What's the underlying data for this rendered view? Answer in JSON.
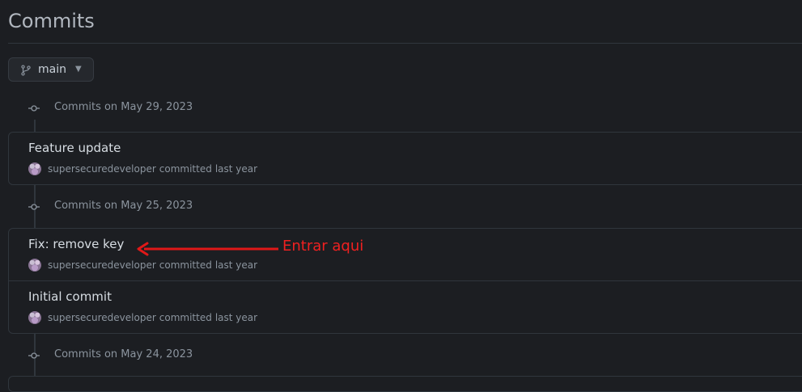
{
  "page": {
    "title": "Commits"
  },
  "branch": {
    "name": "main"
  },
  "groups": [
    {
      "label": "Commits on May 29, 2023",
      "commits": [
        {
          "title": "Feature update",
          "author": "supersecuredeveloper",
          "action": "committed",
          "when": "last year"
        }
      ]
    },
    {
      "label": "Commits on May 25, 2023",
      "commits": [
        {
          "title": "Fix: remove key",
          "author": "supersecuredeveloper",
          "action": "committed",
          "when": "last year"
        },
        {
          "title": "Initial commit",
          "author": "supersecuredeveloper",
          "action": "committed",
          "when": "last year"
        }
      ]
    },
    {
      "label": "Commits on May 24, 2023",
      "commits": []
    }
  ],
  "annotation": {
    "text": "Entrar aqui",
    "color": "#ef2020"
  },
  "icons": {
    "branch": "git-branch-icon",
    "commit": "git-commit-icon",
    "caret": "caret-down-icon"
  }
}
